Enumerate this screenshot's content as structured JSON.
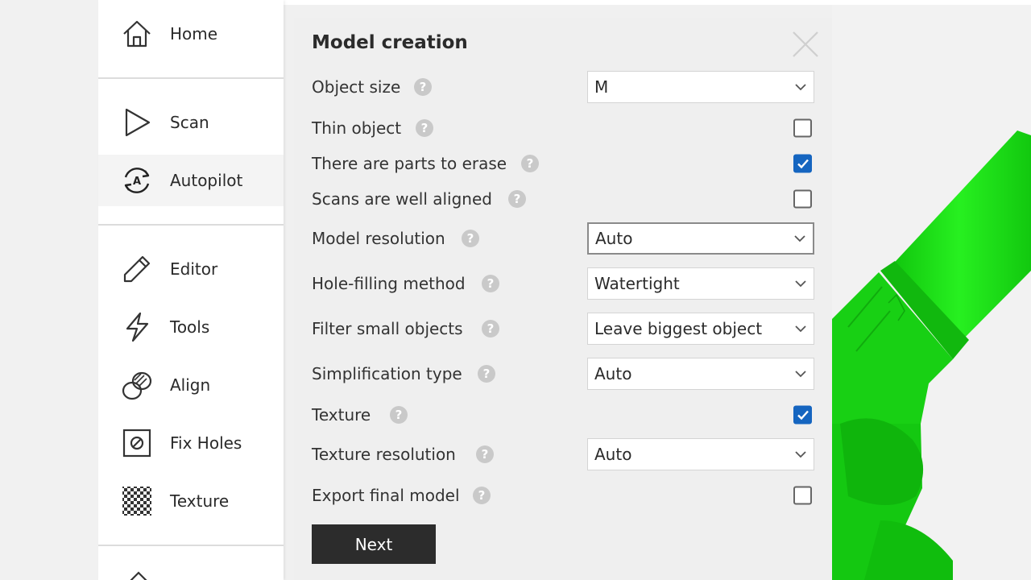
{
  "sidebar": {
    "items": [
      {
        "label": "Home",
        "icon": "home-icon"
      },
      {
        "label": "Scan",
        "icon": "play-icon"
      },
      {
        "label": "Autopilot",
        "icon": "autopilot-icon"
      },
      {
        "label": "Editor",
        "icon": "pencil-icon"
      },
      {
        "label": "Tools",
        "icon": "lightning-icon"
      },
      {
        "label": "Align",
        "icon": "align-icon"
      },
      {
        "label": "Fix Holes",
        "icon": "fix-holes-icon"
      },
      {
        "label": "Texture",
        "icon": "checker-icon"
      }
    ],
    "active": "Autopilot"
  },
  "panel": {
    "title": "Model creation",
    "help_glyph": "?",
    "rows": {
      "object_size": {
        "label": "Object size",
        "value": "M"
      },
      "thin_object": {
        "label": "Thin object",
        "checked": false
      },
      "parts_to_erase": {
        "label": "There are parts to erase",
        "checked": true
      },
      "scans_aligned": {
        "label": "Scans are well aligned",
        "checked": false
      },
      "model_resolution": {
        "label": "Model resolution",
        "value": "Auto"
      },
      "hole_filling": {
        "label": "Hole-filling method",
        "value": "Watertight"
      },
      "filter_small": {
        "label": "Filter small objects",
        "value": "Leave biggest object"
      },
      "simplification": {
        "label": "Simplification type",
        "value": "Auto"
      },
      "texture": {
        "label": "Texture",
        "checked": true
      },
      "texture_resolution": {
        "label": "Texture resolution",
        "value": "Auto"
      },
      "export_final": {
        "label": "Export final model",
        "checked": false
      }
    },
    "next_label": "Next"
  },
  "colors": {
    "accent": "#1565c0",
    "model_green": "#1fe01a",
    "button_dark": "#2c2c2c"
  }
}
